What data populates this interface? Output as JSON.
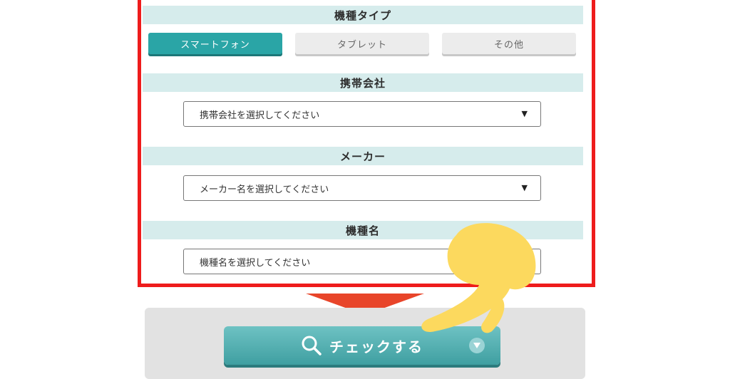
{
  "sections": {
    "type_header": "機種タイプ",
    "carrier_header": "携帯会社",
    "maker_header": "メーカー",
    "model_header": "機種名"
  },
  "device_types": [
    {
      "label": "スマートフォン",
      "selected": true
    },
    {
      "label": "タブレット",
      "selected": false
    },
    {
      "label": "その他",
      "selected": false
    }
  ],
  "selects": {
    "carrier_placeholder": "携帯会社を選択してください",
    "maker_placeholder": "メーカー名を選択してください",
    "model_placeholder": "機種名を選択してください",
    "caret": "▼"
  },
  "check_button": {
    "label": "チェックする",
    "icon": "search-icon"
  },
  "colors": {
    "highlight_frame": "#ee1c1c",
    "accent": "#2aa5a6",
    "section_header_bg": "#d6ecec",
    "arrow": "#e8452a",
    "pointing_hand": "#fcd95e"
  }
}
